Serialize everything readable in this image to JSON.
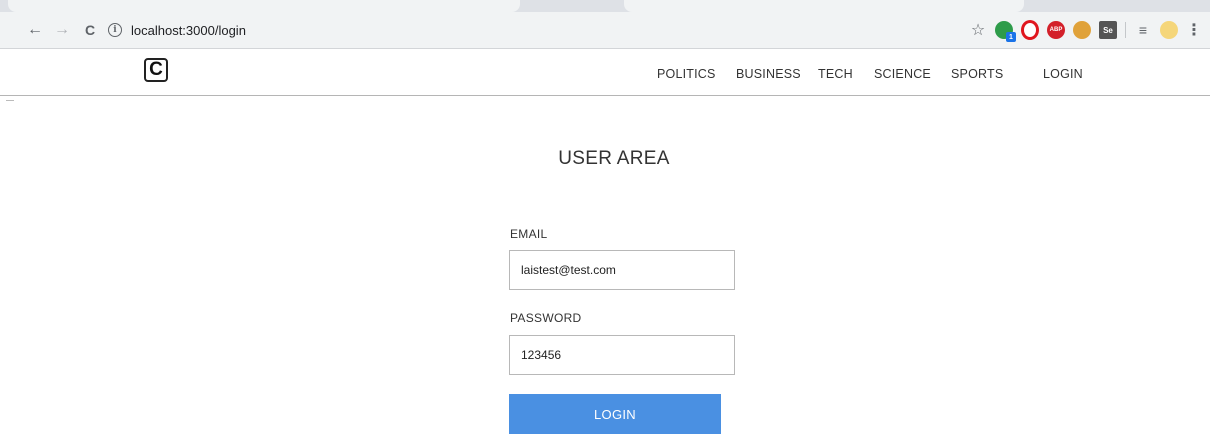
{
  "browser": {
    "url": "localhost:3000/login",
    "back_glyph": "←",
    "forward_glyph": "→",
    "reload_glyph": "C",
    "star_glyph": "☆",
    "menu_glyph": "⋮",
    "extension_icons": [
      "green-extension-icon",
      "opera-icon",
      "adblock-plus-icon",
      "cookie-icon",
      "selenium-icon",
      "reading-list-icon",
      "profile-avatar"
    ],
    "adblock_label": "ABP",
    "selenium_label": "Se",
    "ext_badge": "1"
  },
  "site": {
    "logo_letter": "C",
    "nav": [
      "POLITICS",
      "BUSINESS",
      "TECH",
      "SCIENCE",
      "SPORTS"
    ],
    "nav_login": "LOGIN"
  },
  "form": {
    "title": "USER AREA",
    "email_label": "EMAIL",
    "email_value": "laistest@test.com",
    "password_label": "PASSWORD",
    "password_value": "123456",
    "submit_label": "LOGIN"
  },
  "colors": {
    "accent": "#4a90e2",
    "chrome_bg": "#f1f3f4",
    "border": "#b8b8b8"
  }
}
